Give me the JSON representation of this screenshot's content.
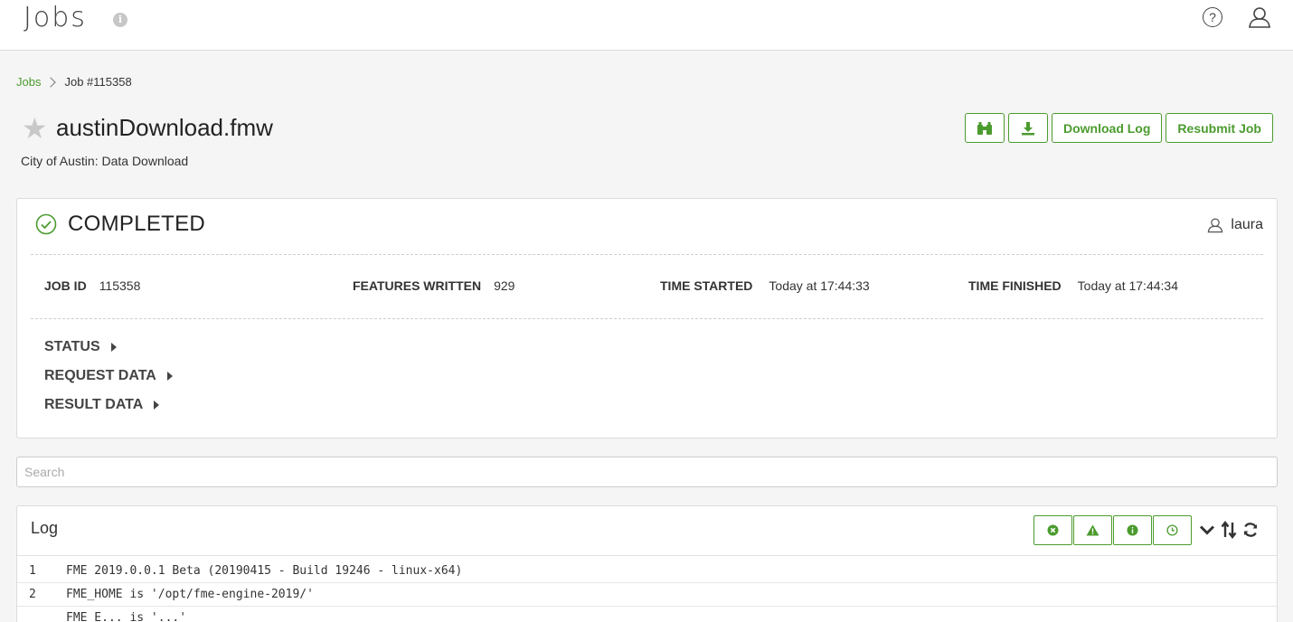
{
  "header": {
    "title": "Jobs",
    "info_icon": "info-circle-icon",
    "help_icon": "question-circle-icon",
    "user_icon": "user-icon"
  },
  "breadcrumb": {
    "root": "Jobs",
    "current": "Job #115358"
  },
  "job": {
    "name": "austinDownload.fmw",
    "subtitle": "City of Austin: Data Download",
    "favorite_icon": "star-icon"
  },
  "actions": {
    "view_icon": "binoculars-icon",
    "download_icon": "download-icon",
    "download_log": "Download Log",
    "resubmit": "Resubmit Job"
  },
  "status": {
    "label": "COMPLETED",
    "icon": "check-circle-icon",
    "user": "laura",
    "color": "#4b9b2e"
  },
  "meta": {
    "job_id_label": "JOB ID",
    "job_id": "115358",
    "features_label": "FEATURES WRITTEN",
    "features": "929",
    "started_label": "TIME STARTED",
    "started": "Today at 17:44:33",
    "finished_label": "TIME FINISHED",
    "finished": "Today at 17:44:34"
  },
  "sections": [
    "STATUS",
    "REQUEST DATA",
    "RESULT DATA"
  ],
  "search": {
    "placeholder": "Search"
  },
  "log": {
    "title": "Log",
    "filter_icons": [
      "error-icon",
      "warning-icon",
      "info-icon",
      "clock-icon"
    ],
    "tool_icons": [
      "chevron-down-icon",
      "sort-icon",
      "refresh-icon"
    ],
    "lines": [
      {
        "num": "1",
        "text": "FME 2019.0.0.1 Beta (20190415 - Build 19246 - linux-x64)"
      },
      {
        "num": "2",
        "text": "FME_HOME is '/opt/fme-engine-2019/'"
      },
      {
        "num": "",
        "text": "FME_E... is '...'"
      }
    ]
  },
  "colors": {
    "accent": "#4b9b2e",
    "background": "#f5f5f5"
  }
}
